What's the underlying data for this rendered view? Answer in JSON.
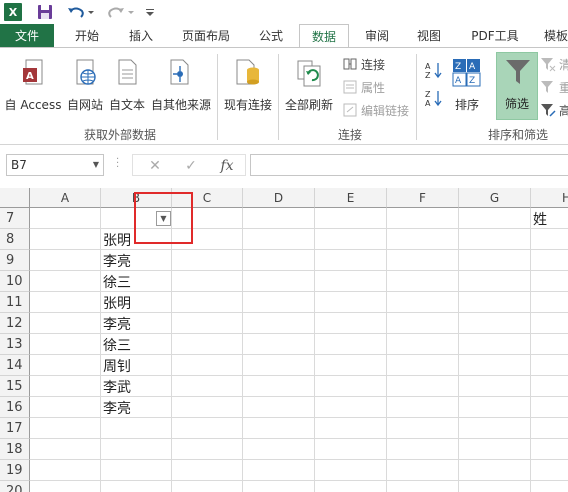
{
  "app": {
    "logo_letter": "X",
    "accent": "#217346"
  },
  "tabs": [
    {
      "label": "文件"
    },
    {
      "label": "开始"
    },
    {
      "label": "插入"
    },
    {
      "label": "页面布局"
    },
    {
      "label": "公式"
    },
    {
      "label": "数据"
    },
    {
      "label": "审阅"
    },
    {
      "label": "视图"
    },
    {
      "label": "PDF工具"
    },
    {
      "label": "模板"
    }
  ],
  "ribbon": {
    "get_external": {
      "from_access": "自 Access",
      "from_web": "自网站",
      "from_text": "自文本",
      "from_other": "自其他来源",
      "group_label": "获取外部数据"
    },
    "existing_connections": "现有连接",
    "connections": {
      "refresh_all": "全部刷新",
      "connections": "连接",
      "properties": "属性",
      "edit_links": "编辑链接",
      "group_label": "连接"
    },
    "sort_filter": {
      "sort": "排序",
      "filter": "筛选",
      "clear": "清",
      "reapply": "重",
      "advanced": "高",
      "group_label": "排序和筛选"
    }
  },
  "formula_bar": {
    "name_box": "B7",
    "cancel_glyph": "✕",
    "enter_glyph": "✓",
    "fx_label": "fx",
    "formula": ""
  },
  "sheet": {
    "columns": [
      "A",
      "B",
      "C",
      "D",
      "E",
      "F",
      "G",
      "H"
    ],
    "rows": [
      "7",
      "8",
      "9",
      "10",
      "11",
      "12",
      "13",
      "14",
      "15",
      "16",
      "17",
      "18",
      "19",
      "20"
    ],
    "cells": {
      "B8": "张明",
      "B9": "李亮",
      "B10": "徐三",
      "B11": "张明",
      "B12": "李亮",
      "B13": "徐三",
      "B14": "周钊",
      "B15": "李武",
      "B16": "李亮",
      "H7": "姓"
    },
    "filter_arrow": "▼"
  }
}
